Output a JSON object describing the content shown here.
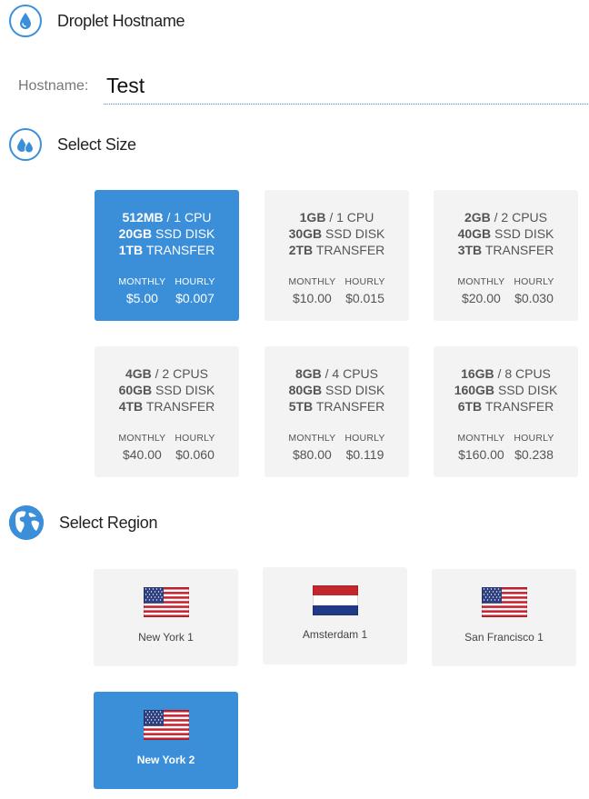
{
  "hostname_section": {
    "title": "Droplet Hostname",
    "icon": "droplet-icon",
    "label": "Hostname:",
    "value": "Test"
  },
  "size_section": {
    "title": "Select Size",
    "icon": "droplets-icon",
    "monthly_label": "MONTHLY",
    "hourly_label": "HOURLY",
    "sizes": [
      {
        "memory": "512MB",
        "cpu": "/ 1 CPU",
        "disk": "20GB",
        "disk_suffix": "SSD DISK",
        "transfer": "1TB",
        "transfer_suffix": "TRANSFER",
        "monthly": "$5.00",
        "hourly": "$0.007",
        "selected": true
      },
      {
        "memory": "1GB",
        "cpu": "/ 1 CPU",
        "disk": "30GB",
        "disk_suffix": "SSD DISK",
        "transfer": "2TB",
        "transfer_suffix": "TRANSFER",
        "monthly": "$10.00",
        "hourly": "$0.015",
        "selected": false
      },
      {
        "memory": "2GB",
        "cpu": "/ 2 CPUS",
        "disk": "40GB",
        "disk_suffix": "SSD DISK",
        "transfer": "3TB",
        "transfer_suffix": "TRANSFER",
        "monthly": "$20.00",
        "hourly": "$0.030",
        "selected": false
      },
      {
        "memory": "4GB",
        "cpu": "/ 2 CPUS",
        "disk": "60GB",
        "disk_suffix": "SSD DISK",
        "transfer": "4TB",
        "transfer_suffix": "TRANSFER",
        "monthly": "$40.00",
        "hourly": "$0.060",
        "selected": false
      },
      {
        "memory": "8GB",
        "cpu": "/ 4 CPUS",
        "disk": "80GB",
        "disk_suffix": "SSD DISK",
        "transfer": "5TB",
        "transfer_suffix": "TRANSFER",
        "monthly": "$80.00",
        "hourly": "$0.119",
        "selected": false
      },
      {
        "memory": "16GB",
        "cpu": "/ 8 CPUS",
        "disk": "160GB",
        "disk_suffix": "SSD DISK",
        "transfer": "6TB",
        "transfer_suffix": "TRANSFER",
        "monthly": "$160.00",
        "hourly": "$0.238",
        "selected": false
      }
    ]
  },
  "region_section": {
    "title": "Select Region",
    "icon": "globe-icon",
    "regions": [
      {
        "name": "New York 1",
        "flag": "us-flag-icon",
        "selected": false
      },
      {
        "name": "Amsterdam 1",
        "flag": "nl-flag-icon",
        "selected": false
      },
      {
        "name": "San Francisco 1",
        "flag": "us-flag-icon",
        "selected": false
      },
      {
        "name": "New York 2",
        "flag": "us-flag-icon",
        "selected": true
      }
    ]
  },
  "colors": {
    "accent": "#3b8fd9",
    "card_bg": "#f3f3f3"
  }
}
